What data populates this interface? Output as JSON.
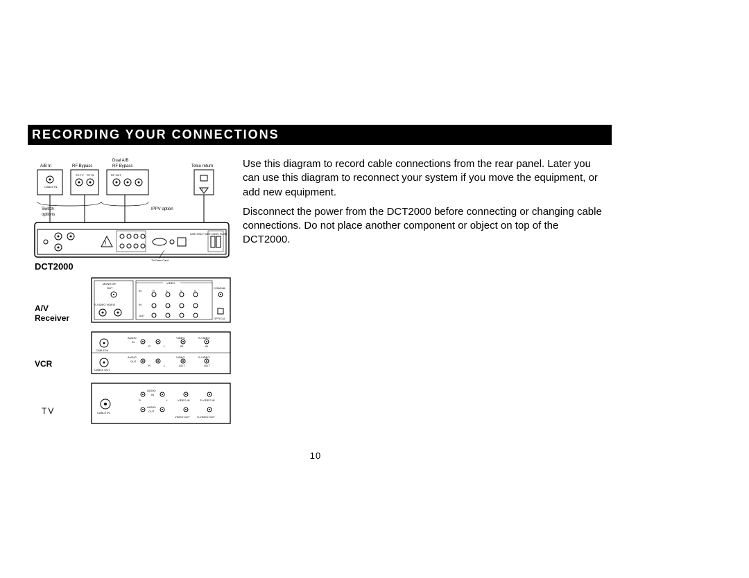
{
  "title": "RECORDING YOUR CONNECTIONS",
  "paragraphs": {
    "p1": "Use this diagram to record cable connections from the rear panel. Later you can use this diagram to reconnect your system if you move the equipment, or add new equipment.",
    "p2": "Disconnect the power from the DCT2000 before connecting or changing cable connections. Do not place another component or object on top of the DCT2000."
  },
  "page_number": "10",
  "diagram": {
    "top_options": {
      "ab_in": "A/B In",
      "rf_bypass": "RF Bypass",
      "dual_ab_rf_bypass_top": "Dual A/B",
      "dual_ab_rf_bypass_bot": "RF Bypass",
      "telco_return": "Telco return",
      "switch_options_top": "Switch",
      "switch_options_bot": "options",
      "ippv_option": "IPPV option"
    },
    "option_ports": {
      "cable_in": "CABLE IN",
      "to_tv": "TO TV",
      "rf_in": "RF IN",
      "rf_out": "RF OUT"
    },
    "main_unit": {
      "label": "DCT2000",
      "tv_pass_card": "TV Pass Card",
      "info": "USE ONLY WITH 250V FUSE"
    },
    "av_receiver": {
      "label_top": "A/V",
      "label_bot": "Receiver",
      "monitor_out_top": "MONITOR",
      "monitor_out_bot": "OUT",
      "svideo_video": "S-VIDEO VIDEO",
      "video_header": "VIDEO",
      "in": "IN",
      "out": "OUT",
      "r": "R",
      "l": "L",
      "v": "V",
      "s": "S",
      "coaxial": "COAXIAL",
      "optical": "OPTICAL"
    },
    "vcr": {
      "label": "VCR",
      "cable_in": "CABLE IN",
      "cable_out": "CABLE OUT",
      "audio_in_top": "AUDIO",
      "audio_in_bot": "IN",
      "audio_out_top": "AUDIO",
      "audio_out_bot": "OUT",
      "r": "R",
      "l": "L",
      "video_in_top": "VIDEO",
      "video_in_bot": "IN",
      "video_out_top": "VIDEO",
      "video_out_bot": "OUT",
      "svideo_in_top": "S-VIDEO",
      "svideo_in_bot": "IN",
      "svideo_out_top": "S-VIDEO",
      "svideo_out_bot": "OUT"
    },
    "tv": {
      "label": "TV",
      "cable_in": "CABLE IN",
      "audio_in_top": "AUDIO",
      "audio_in_bot": "IN",
      "audio_out_top": "AUDIO",
      "audio_out_bot": "OUT",
      "r": "R",
      "l": "L",
      "video_in": "VIDEO IN",
      "video_out": "VIDEO OUT",
      "svideo_in": "S-VIDEO IN",
      "svideo_out": "S-VIDEO OUT"
    }
  }
}
